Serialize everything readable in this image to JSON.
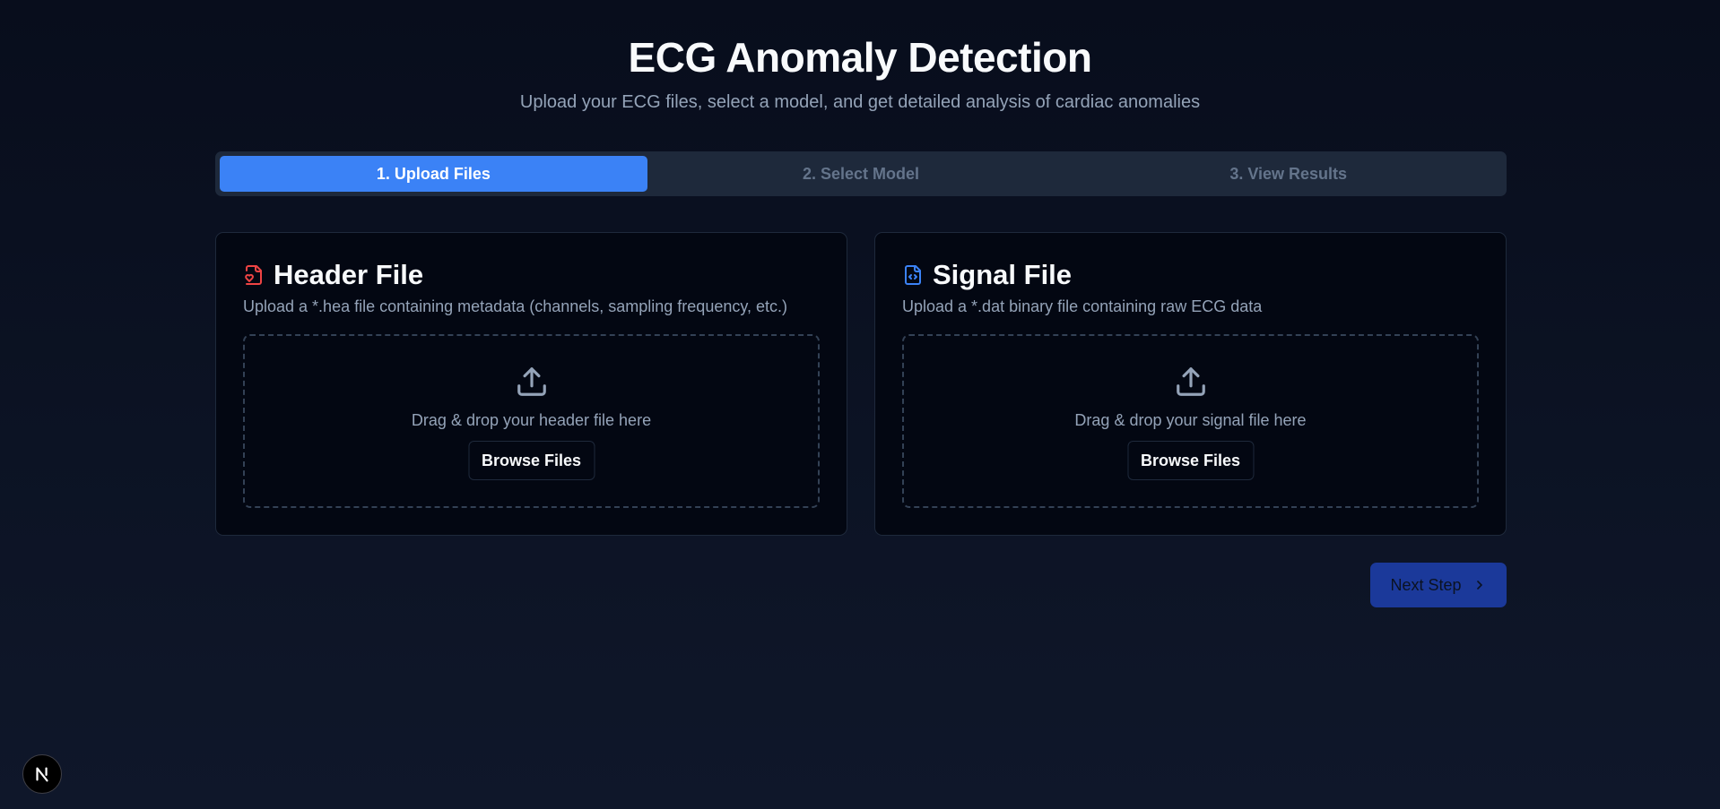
{
  "header": {
    "title": "ECG Anomaly Detection",
    "subtitle": "Upload your ECG files, select a model, and get detailed analysis of cardiac anomalies"
  },
  "steps": [
    {
      "label": "1. Upload Files",
      "active": true
    },
    {
      "label": "2. Select Model",
      "active": false
    },
    {
      "label": "3. View Results",
      "active": false
    }
  ],
  "cards": {
    "header_file": {
      "icon": "file-heart-icon",
      "title": "Header File",
      "description": "Upload a *.hea file containing metadata (channels, sampling frequency, etc.)",
      "drop_text": "Drag & drop your header file here",
      "browse_label": "Browse Files"
    },
    "signal_file": {
      "icon": "file-code-icon",
      "title": "Signal File",
      "description": "Upload a *.dat binary file containing raw ECG data",
      "drop_text": "Drag & drop your signal file here",
      "browse_label": "Browse Files"
    }
  },
  "actions": {
    "next_label": "Next Step",
    "next_icon": "chevron-right-icon"
  },
  "badge": {
    "icon": "nextjs-logo-icon"
  },
  "colors": {
    "accent": "#3b82f6",
    "header_icon": "#ef4444",
    "signal_icon": "#3b82f6",
    "next_button": "#1e40af"
  }
}
